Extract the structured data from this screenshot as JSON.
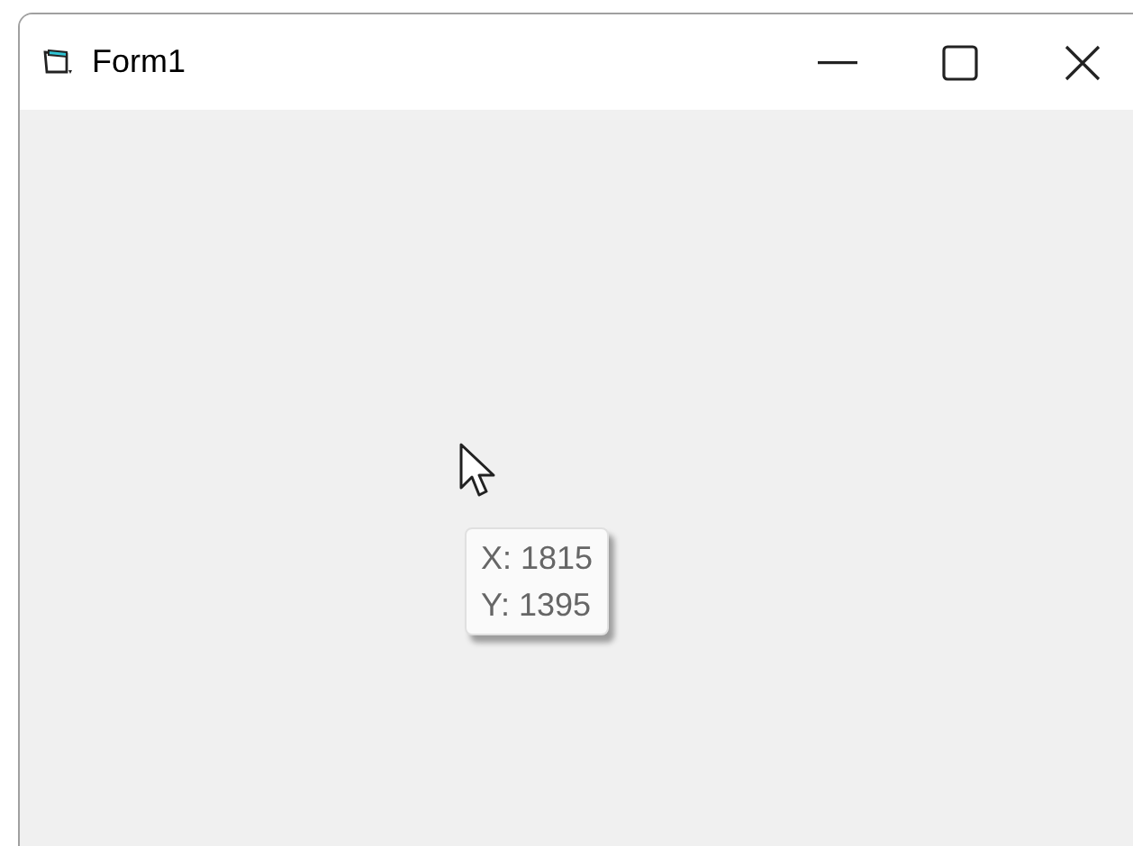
{
  "window": {
    "title": "Form1"
  },
  "tooltip": {
    "lines": [
      "X: 1815",
      "Y: 1395"
    ]
  }
}
